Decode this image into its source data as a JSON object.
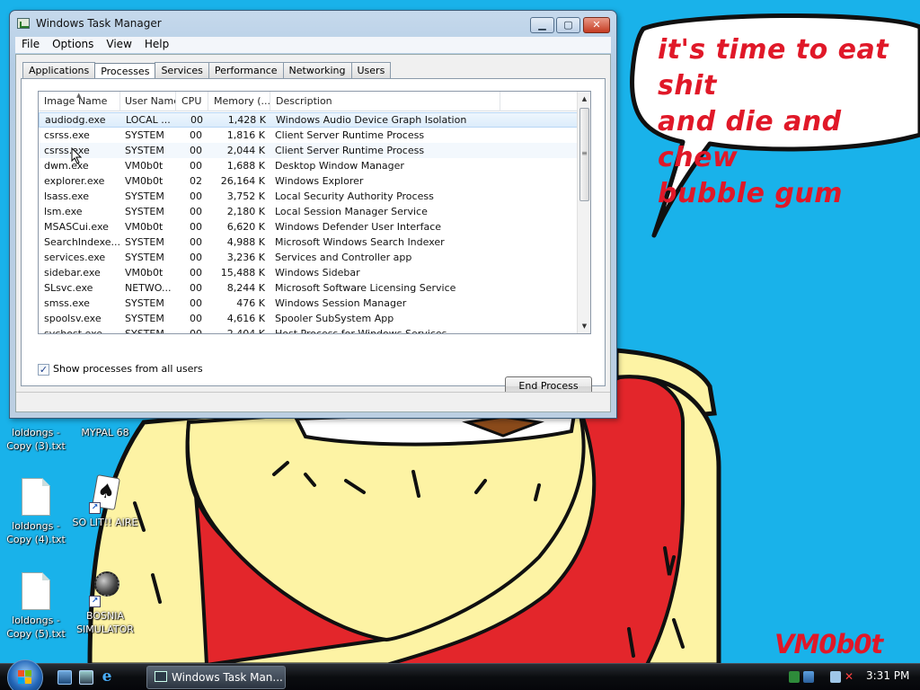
{
  "desktop": {
    "caption": "it's time to eat shit\nand die and chew\nbubble gum",
    "signature": "VM0b0t",
    "icons": [
      {
        "label": "loldongs -\nCopy (3).txt",
        "icon": "text-document-icon"
      },
      {
        "label": "MYPAL 68",
        "icon": "browser-shortcut-icon"
      },
      {
        "label": "loldongs -\nCopy (4).txt",
        "icon": "text-document-icon"
      },
      {
        "label": "SO LIT!! AIRE",
        "icon": "solitaire-shortcut-icon"
      },
      {
        "label": "loldongs -\nCopy (5).txt",
        "icon": "text-document-icon"
      },
      {
        "label": "BOSNIA\nSIMULATOR",
        "icon": "minesweeper-shortcut-icon"
      }
    ],
    "colors": {
      "sky": "#19b2ea",
      "shirt": "#e3262b",
      "skin": "#fdf3a4",
      "text_red": "#e01828"
    }
  },
  "window": {
    "title": "Windows Task Manager",
    "controls": {
      "minimize": "▁",
      "maximize": "▢",
      "close": "✕"
    },
    "menu": [
      "File",
      "Options",
      "View",
      "Help"
    ],
    "tabs": [
      "Applications",
      "Processes",
      "Services",
      "Performance",
      "Networking",
      "Users"
    ],
    "active_tab": "Processes",
    "columns": [
      "Image Name",
      "User Name",
      "CPU",
      "Memory (...",
      "Description"
    ],
    "sorted_column": "Image Name",
    "processes": [
      {
        "name": "audiodg.exe",
        "user": "LOCAL ...",
        "cpu": "00",
        "memory": "1,428 K",
        "desc": "Windows Audio Device Graph Isolation"
      },
      {
        "name": "csrss.exe",
        "user": "SYSTEM",
        "cpu": "00",
        "memory": "1,816 K",
        "desc": "Client Server Runtime Process"
      },
      {
        "name": "csrss.exe",
        "user": "SYSTEM",
        "cpu": "00",
        "memory": "2,044 K",
        "desc": "Client Server Runtime Process"
      },
      {
        "name": "dwm.exe",
        "user": "VM0b0t",
        "cpu": "00",
        "memory": "1,688 K",
        "desc": "Desktop Window Manager"
      },
      {
        "name": "explorer.exe",
        "user": "VM0b0t",
        "cpu": "02",
        "memory": "26,164 K",
        "desc": "Windows Explorer"
      },
      {
        "name": "lsass.exe",
        "user": "SYSTEM",
        "cpu": "00",
        "memory": "3,752 K",
        "desc": "Local Security Authority Process"
      },
      {
        "name": "lsm.exe",
        "user": "SYSTEM",
        "cpu": "00",
        "memory": "2,180 K",
        "desc": "Local Session Manager Service"
      },
      {
        "name": "MSASCui.exe",
        "user": "VM0b0t",
        "cpu": "00",
        "memory": "6,620 K",
        "desc": "Windows Defender User Interface"
      },
      {
        "name": "SearchIndexe...",
        "user": "SYSTEM",
        "cpu": "00",
        "memory": "4,988 K",
        "desc": "Microsoft Windows Search Indexer"
      },
      {
        "name": "services.exe",
        "user": "SYSTEM",
        "cpu": "00",
        "memory": "3,236 K",
        "desc": "Services and Controller app"
      },
      {
        "name": "sidebar.exe",
        "user": "VM0b0t",
        "cpu": "00",
        "memory": "15,488 K",
        "desc": "Windows Sidebar"
      },
      {
        "name": "SLsvc.exe",
        "user": "NETWO...",
        "cpu": "00",
        "memory": "8,244 K",
        "desc": "Microsoft Software Licensing Service"
      },
      {
        "name": "smss.exe",
        "user": "SYSTEM",
        "cpu": "00",
        "memory": "476 K",
        "desc": "Windows Session Manager"
      },
      {
        "name": "spoolsv.exe",
        "user": "SYSTEM",
        "cpu": "00",
        "memory": "4,616 K",
        "desc": "Spooler SubSystem App"
      },
      {
        "name": "svchost.exe",
        "user": "SYSTEM",
        "cpu": "00",
        "memory": "2,404 K",
        "desc": "Host Process for Windows Services"
      }
    ],
    "selected_row": 0,
    "hover_row": 2,
    "show_all_label": "Show processes from all users",
    "show_all_checked": true,
    "end_process_label": "End Process"
  },
  "taskbar": {
    "task_button_label": "Windows Task Man...",
    "clock": "3:31 PM"
  }
}
